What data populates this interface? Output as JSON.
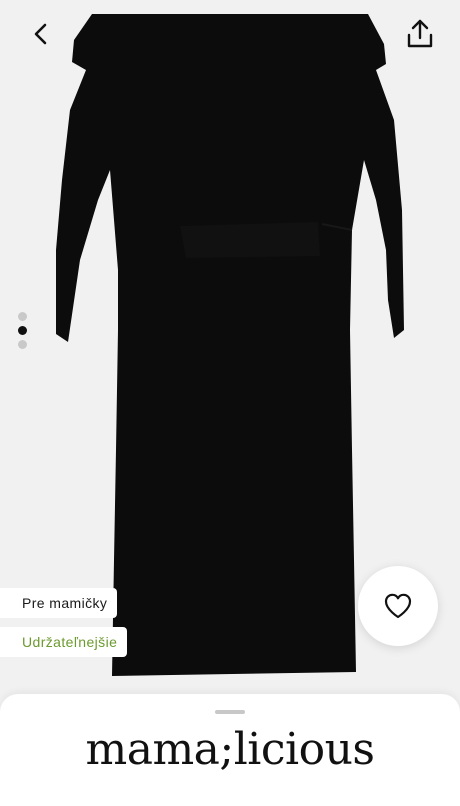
{
  "navigation": {
    "back_icon": "chevron-left-icon",
    "share_icon": "share-upload-icon"
  },
  "gallery": {
    "image_subject": "black-wrap-dress-back-view",
    "total_images": 3,
    "active_index": 1
  },
  "tags": {
    "maternity": "Pre mamičky",
    "sustainable": "Udržateľnejšie"
  },
  "wishlist": {
    "icon": "heart-outline-icon"
  },
  "brand": {
    "name": "mama;licious"
  },
  "colors": {
    "sustainable_green": "#6b9a2f",
    "background": "#f1f1f1",
    "dress": "#0c0c0c"
  }
}
